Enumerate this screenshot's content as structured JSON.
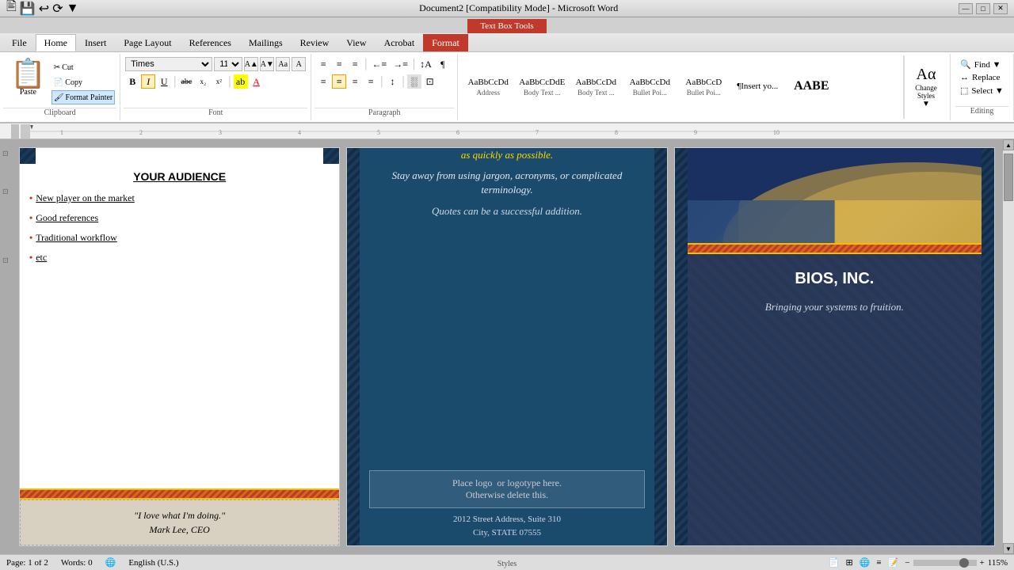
{
  "titlebar": {
    "title": "Document2 [Compatibility Mode] - Microsoft Word",
    "left_icons": [
      "🖹",
      "💾",
      "↩",
      "⟳"
    ],
    "right_icons": [
      "—",
      "□",
      "✕"
    ]
  },
  "context_tab": {
    "label": "Text Box Tools"
  },
  "ribbon_tabs": [
    {
      "label": "File",
      "active": false
    },
    {
      "label": "Home",
      "active": true
    },
    {
      "label": "Insert",
      "active": false
    },
    {
      "label": "Page Layout",
      "active": false
    },
    {
      "label": "References",
      "active": false
    },
    {
      "label": "Mailings",
      "active": false
    },
    {
      "label": "Review",
      "active": false
    },
    {
      "label": "View",
      "active": false
    },
    {
      "label": "Acrobat",
      "active": false
    },
    {
      "label": "Format",
      "active": true,
      "context": true
    }
  ],
  "clipboard": {
    "paste_label": "Paste",
    "cut_label": "Cut",
    "copy_label": "Copy",
    "format_painter_label": "Format Painter",
    "group_label": "Clipboard"
  },
  "font": {
    "font_name": "Times",
    "font_size": "11",
    "bold": "B",
    "italic": "I",
    "underline": "U",
    "strikethrough": "abc",
    "subscript": "x₂",
    "superscript": "x²",
    "grow": "A",
    "shrink": "A",
    "change_case": "Aa",
    "clear_format": "A",
    "highlight": "ab",
    "font_color": "A",
    "group_label": "Font"
  },
  "paragraph": {
    "bullets": "≡",
    "numbering": "≡",
    "multilevel": "≡",
    "decrease_indent": "←",
    "increase_indent": "→",
    "sort": "↕",
    "show_marks": "¶",
    "align_left": "≡",
    "align_center": "≡",
    "align_right": "≡",
    "justify": "≡",
    "line_spacing": "↕",
    "shading": "░",
    "borders": "□",
    "group_label": "Paragraph"
  },
  "styles": {
    "items": [
      {
        "label": "AaBbCcDd",
        "name": "Address",
        "style": "normal"
      },
      {
        "label": "AaBbCcDdE",
        "name": "Body Text ...",
        "style": "normal"
      },
      {
        "label": "AaBbCcDd",
        "name": "Body Text ...",
        "style": "normal"
      },
      {
        "label": "AaBbCcDd",
        "name": "Bullet Poi...",
        "style": "normal"
      },
      {
        "label": "AaBbCcD",
        "name": "Bullet Poi...",
        "style": "normal"
      },
      {
        "label": "¶Insert yo...",
        "name": "¶Insert yo...",
        "style": "normal"
      },
      {
        "label": "AABE",
        "name": "",
        "style": "heading"
      }
    ],
    "change_styles_label": "Change\nStyles",
    "select_label": "Select ▼",
    "group_label": "Styles"
  },
  "editing": {
    "find_label": "Find ▼",
    "replace_label": "Replace",
    "select_label": "Select ▼",
    "group_label": "Editing"
  },
  "document": {
    "page1": {
      "title": "YOUR AUDIENCE",
      "bullets": [
        {
          "text": "New player on the market"
        },
        {
          "text": "Good references"
        },
        {
          "text": "Traditional workflow"
        },
        {
          "text": "etc"
        }
      ],
      "quote": "\"I love what I'm doing.\"\nMark Lee, CEO"
    },
    "page2": {
      "text1": "as quickly as possible.",
      "text2": "Stay away from using jargon, acronyms,\nor complicated terminology.",
      "text3": "Quotes can be a successful addition.",
      "logo_placeholder": "Place logo  or logotype here.\nOtherwise delete this.",
      "address1": "2012 Street Address,  Suite 310",
      "address2": "City, STATE 07555"
    },
    "page3": {
      "company_name": "BIOS, INC.",
      "tagline": "Bringing your systems to fruition."
    }
  },
  "statusbar": {
    "page_info": "Page: 1 of 2",
    "words": "Words: 0",
    "language": "English (U.S.)",
    "zoom": "115%"
  }
}
